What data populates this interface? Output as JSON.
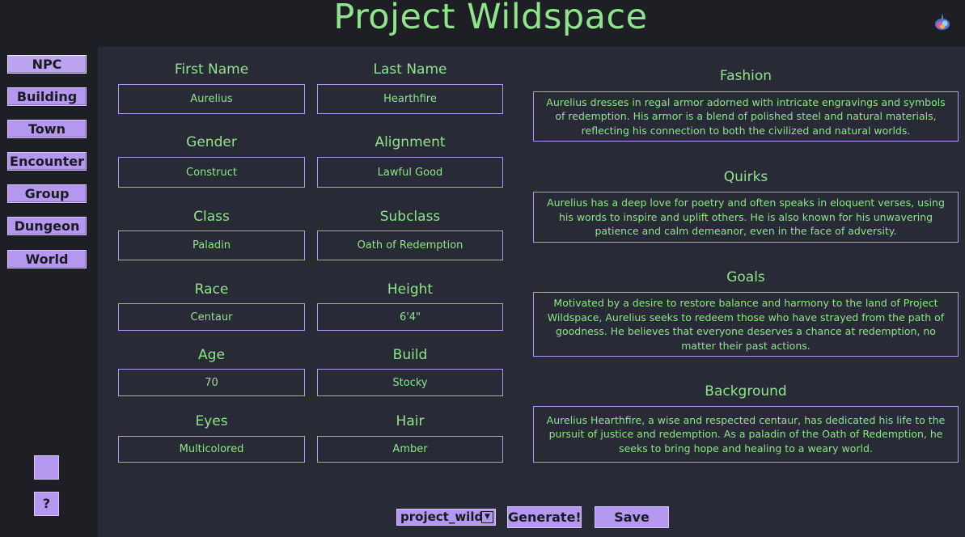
{
  "header": {
    "title": "Project Wildspace",
    "logo_icon": "app-logo-icon"
  },
  "sidebar": {
    "items": [
      {
        "label": "NPC"
      },
      {
        "label": "Building"
      },
      {
        "label": "Town"
      },
      {
        "label": "Encounter"
      },
      {
        "label": "Group"
      },
      {
        "label": "Dungeon"
      },
      {
        "label": "World"
      }
    ],
    "blank_button": "",
    "help_button": "?"
  },
  "npc": {
    "first_name": {
      "label": "First Name",
      "value": "Aurelius"
    },
    "last_name": {
      "label": "Last Name",
      "value": "Hearthfire"
    },
    "gender": {
      "label": "Gender",
      "value": "Construct"
    },
    "alignment": {
      "label": "Alignment",
      "value": "Lawful Good"
    },
    "class": {
      "label": "Class",
      "value": "Paladin"
    },
    "subclass": {
      "label": "Subclass",
      "value": "Oath of Redemption"
    },
    "race": {
      "label": "Race",
      "value": "Centaur"
    },
    "height": {
      "label": "Height",
      "value": "6'4\""
    },
    "age": {
      "label": "Age",
      "value": "70"
    },
    "build": {
      "label": "Build",
      "value": "Stocky"
    },
    "eyes": {
      "label": "Eyes",
      "value": "Multicolored"
    },
    "hair": {
      "label": "Hair",
      "value": "Amber"
    }
  },
  "details": {
    "fashion": {
      "label": "Fashion",
      "text": "Aurelius dresses in regal armor adorned with intricate engravings and symbols of redemption. His armor is a blend of polished steel and natural materials, reflecting his connection to both the civilized and natural worlds."
    },
    "quirks": {
      "label": "Quirks",
      "text": "Aurelius has a deep love for poetry and often speaks in eloquent verses, using his words to inspire and uplift others. He is also known for his unwavering patience and calm demeanor, even in the face of adversity."
    },
    "goals": {
      "label": "Goals",
      "text": "Motivated by a desire to restore balance and harmony to the land of Project Wildspace, Aurelius seeks to redeem those who have strayed from the path of goodness. He believes that everyone deserves a chance at redemption, no matter their past actions."
    },
    "background": {
      "label": "Background",
      "text": "Aurelius Hearthfire, a wise and respected centaur, has dedicated his life to the pursuit of justice and redemption. As a paladin of the Oath of Redemption, he seeks to bring hope and healing to a weary world."
    }
  },
  "footer": {
    "project_select": "project_wild",
    "generate_label": "Generate!",
    "save_label": "Save"
  },
  "colors": {
    "accent": "#b497ee",
    "text": "#8ee58a",
    "panel": "#282a36",
    "bg": "#1e1f25"
  }
}
